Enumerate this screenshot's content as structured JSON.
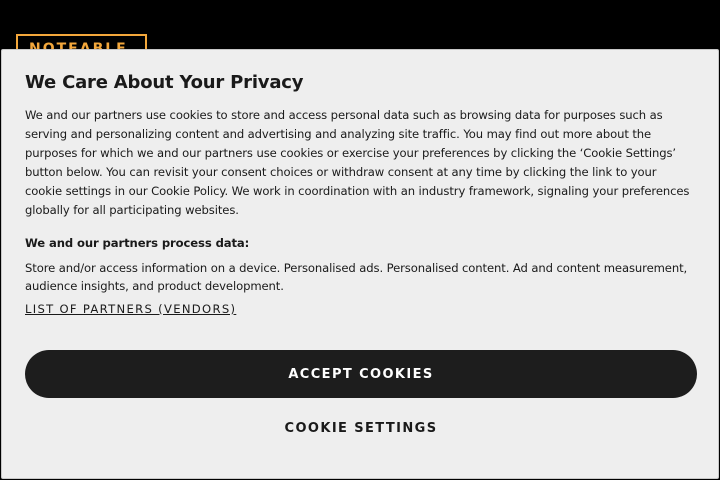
{
  "site": {
    "logo_text": "NOTEABLE",
    "logo_color": "#f3a73b"
  },
  "consent": {
    "title": "We Care About Your Privacy",
    "policy_text": "We and our partners use cookies to store and access personal data such as browsing data for purposes such as serving and personalizing content and advertising and analyzing site traffic. You may find out more about the purposes for which we and our partners use cookies or exercise your preferences by clicking the ‘Cookie Settings’ button below. You can revisit your consent choices or withdraw consent at any time by clicking the link to your cookie settings in our Cookie Policy. We work in coordination with an industry framework, signaling your preferences globally for all participating websites.",
    "process_title": "We and our partners process data:",
    "process_text": "Store and/or access information on a device. Personalised ads. Personalised content. Ad and content measurement, audience insights, and product development.",
    "vendors_link": "LIST OF PARTNERS (VENDORS)",
    "accept_label": "ACCEPT COOKIES",
    "settings_label": "COOKIE SETTINGS"
  }
}
